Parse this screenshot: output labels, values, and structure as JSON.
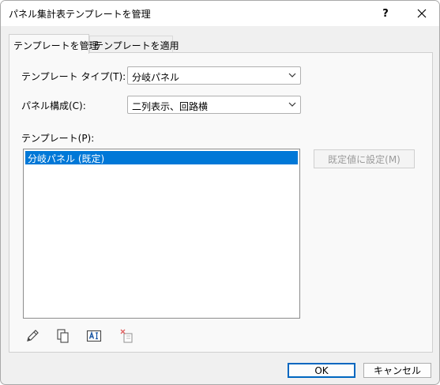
{
  "window": {
    "title": "パネル集計表テンプレートを管理",
    "help_label": "?"
  },
  "tabs": [
    {
      "label": "テンプレートを管理",
      "active": true
    },
    {
      "label": "テンプレートを適用",
      "active": false
    }
  ],
  "form": {
    "template_type_label": "テンプレート タイプ(T):",
    "template_type_value": "分岐パネル",
    "panel_config_label": "パネル構成(C):",
    "panel_config_value": "二列表示、回路横",
    "templates_label": "テンプレート(P):"
  },
  "templates": {
    "items": [
      {
        "label": "分岐パネル (既定)",
        "selected": true
      }
    ]
  },
  "buttons": {
    "set_default": "既定値に設定(M)",
    "ok": "OK",
    "cancel": "キャンセル"
  },
  "toolbar_icons": [
    "edit-pencil-icon",
    "duplicate-icon",
    "rename-icon",
    "delete-icon"
  ],
  "colors": {
    "selection": "#0078d7",
    "default_button_border": "#0067c0"
  }
}
